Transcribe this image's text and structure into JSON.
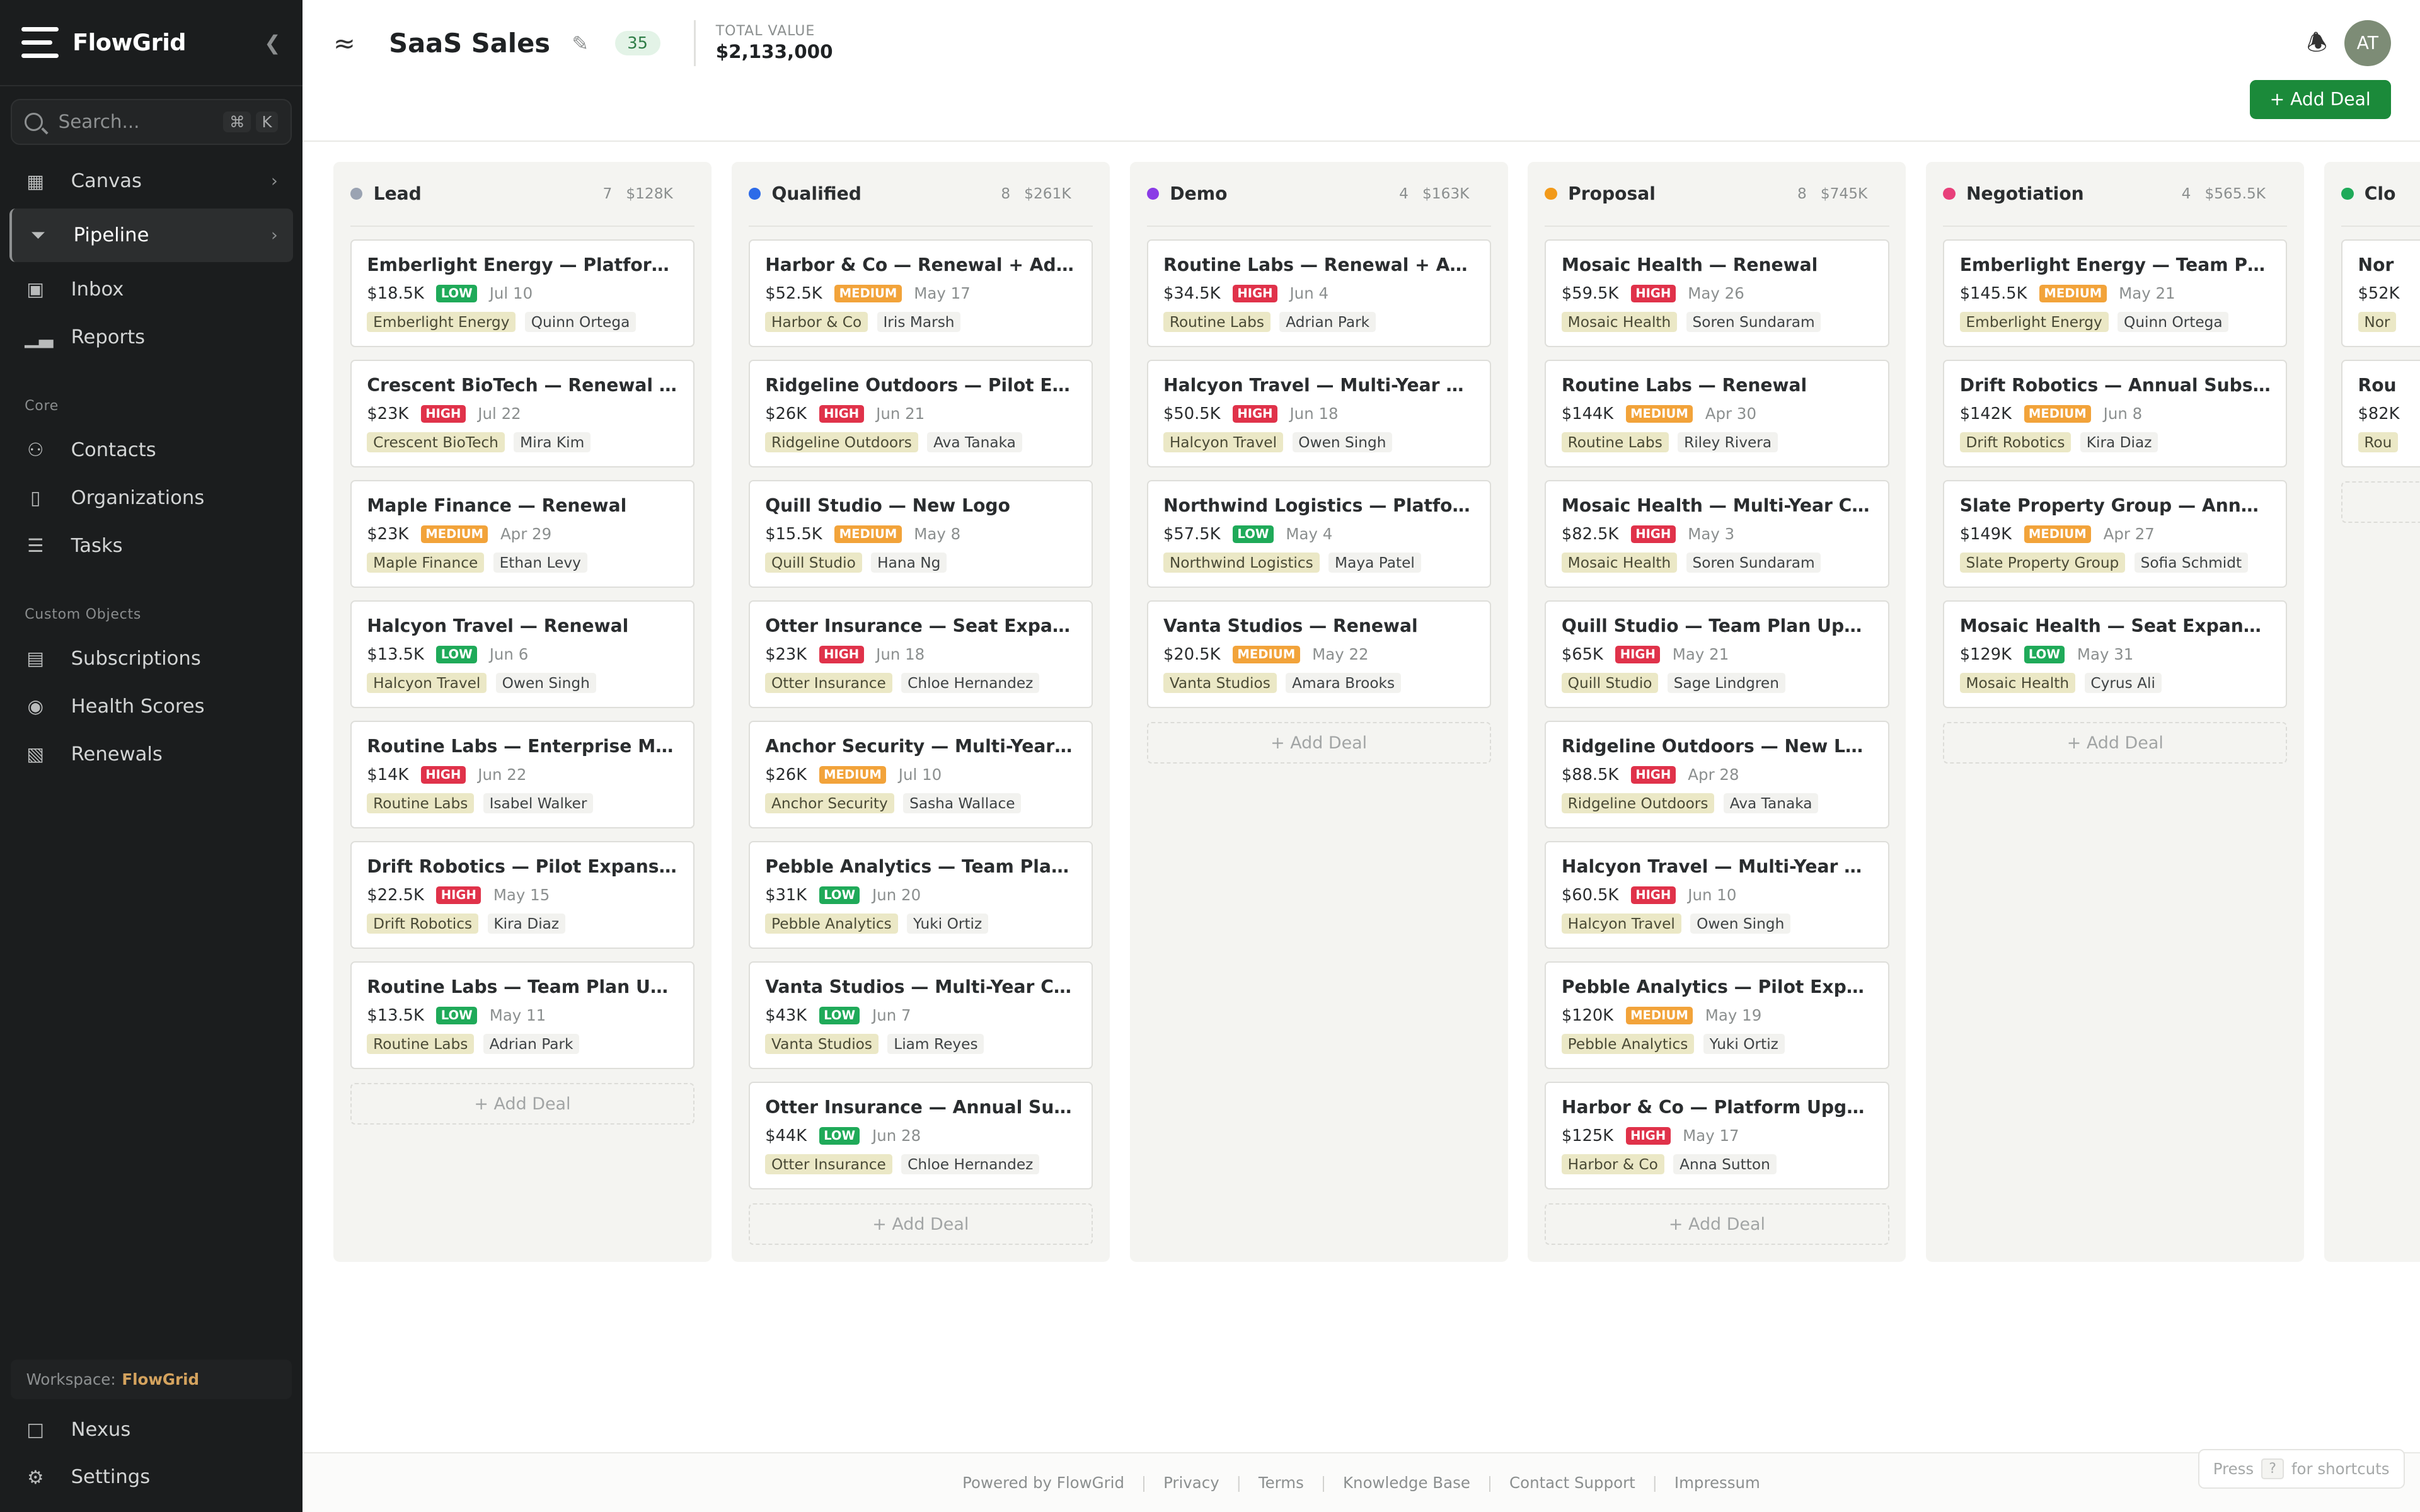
{
  "app": {
    "name": "FlowGrid"
  },
  "sidebar": {
    "search_placeholder": "Search...",
    "shortcut": [
      "⌘",
      "K"
    ],
    "nav": [
      {
        "label": "Canvas",
        "icon": "grid-icon"
      },
      {
        "label": "Pipeline",
        "icon": "filter-icon",
        "active": true
      },
      {
        "label": "Inbox",
        "icon": "inbox-icon"
      },
      {
        "label": "Reports",
        "icon": "bar-chart-icon"
      }
    ],
    "core_label": "Core",
    "core": [
      {
        "label": "Contacts",
        "icon": "users-icon"
      },
      {
        "label": "Organizations",
        "icon": "building-icon"
      },
      {
        "label": "Tasks",
        "icon": "list-icon"
      }
    ],
    "custom_label": "Custom Objects",
    "custom": [
      {
        "label": "Subscriptions",
        "icon": "subscriptions-icon"
      },
      {
        "label": "Health Scores",
        "icon": "health-icon"
      },
      {
        "label": "Renewals",
        "icon": "renewals-icon"
      }
    ],
    "workspace_label": "Workspace:",
    "workspace_name": "FlowGrid",
    "bottom": [
      {
        "label": "Nexus",
        "icon": "chat-icon"
      },
      {
        "label": "Settings",
        "icon": "gear-icon"
      }
    ]
  },
  "header": {
    "title": "SaaS Sales",
    "count": "35",
    "total_label": "TOTAL VALUE",
    "total_value": "$2,133,000",
    "avatar": "AT",
    "add_deal": "+ Add Deal"
  },
  "board": {
    "add_label": "+ Add Deal",
    "columns": [
      {
        "name": "Lead",
        "color": "#9aa3b2",
        "count": "7",
        "total": "$128K",
        "cards": [
          {
            "title": "Emberlight Energy — Platform Upgrade",
            "amount": "$18.5K",
            "priority": "LOW",
            "date": "Jul 10",
            "org": "Emberlight Energy",
            "person": "Quinn Ortega"
          },
          {
            "title": "Crescent BioTech — Renewal + Add-On",
            "amount": "$23K",
            "priority": "HIGH",
            "date": "Jul 22",
            "org": "Crescent BioTech",
            "person": "Mira Kim"
          },
          {
            "title": "Maple Finance — Renewal",
            "amount": "$23K",
            "priority": "MEDIUM",
            "date": "Apr 29",
            "org": "Maple Finance",
            "person": "Ethan Levy"
          },
          {
            "title": "Halcyon Travel — Renewal",
            "amount": "$13.5K",
            "priority": "LOW",
            "date": "Jun 6",
            "org": "Halcyon Travel",
            "person": "Owen Singh"
          },
          {
            "title": "Routine Labs — Enterprise Migration",
            "amount": "$14K",
            "priority": "HIGH",
            "date": "Jun 22",
            "org": "Routine Labs",
            "person": "Isabel Walker"
          },
          {
            "title": "Drift Robotics — Pilot Expansion",
            "amount": "$22.5K",
            "priority": "HIGH",
            "date": "May 15",
            "org": "Drift Robotics",
            "person": "Kira Diaz"
          },
          {
            "title": "Routine Labs — Team Plan Upgrade",
            "amount": "$13.5K",
            "priority": "LOW",
            "date": "May 11",
            "org": "Routine Labs",
            "person": "Adrian Park"
          }
        ]
      },
      {
        "name": "Qualified",
        "color": "#2d6be8",
        "count": "8",
        "total": "$261K",
        "cards": [
          {
            "title": "Harbor & Co — Renewal + Add-On",
            "amount": "$52.5K",
            "priority": "MEDIUM",
            "date": "May 17",
            "org": "Harbor & Co",
            "person": "Iris Marsh"
          },
          {
            "title": "Ridgeline Outdoors — Pilot Expansion",
            "amount": "$26K",
            "priority": "HIGH",
            "date": "Jun 21",
            "org": "Ridgeline Outdoors",
            "person": "Ava Tanaka"
          },
          {
            "title": "Quill Studio — New Logo",
            "amount": "$15.5K",
            "priority": "MEDIUM",
            "date": "May 8",
            "org": "Quill Studio",
            "person": "Hana Ng"
          },
          {
            "title": "Otter Insurance — Seat Expansion",
            "amount": "$23K",
            "priority": "HIGH",
            "date": "Jun 18",
            "org": "Otter Insurance",
            "person": "Chloe Hernandez"
          },
          {
            "title": "Anchor Security — Multi-Year Contract",
            "amount": "$26K",
            "priority": "MEDIUM",
            "date": "Jul 10",
            "org": "Anchor Security",
            "person": "Sasha Wallace"
          },
          {
            "title": "Pebble Analytics — Team Plan Upgrade",
            "amount": "$31K",
            "priority": "LOW",
            "date": "Jun 20",
            "org": "Pebble Analytics",
            "person": "Yuki Ortiz"
          },
          {
            "title": "Vanta Studios — Multi-Year Contract",
            "amount": "$43K",
            "priority": "LOW",
            "date": "Jun 7",
            "org": "Vanta Studios",
            "person": "Liam Reyes"
          },
          {
            "title": "Otter Insurance — Annual Subscription",
            "amount": "$44K",
            "priority": "LOW",
            "date": "Jun 28",
            "org": "Otter Insurance",
            "person": "Chloe Hernandez"
          }
        ]
      },
      {
        "name": "Demo",
        "color": "#8a3ce6",
        "count": "4",
        "total": "$163K",
        "cards": [
          {
            "title": "Routine Labs — Renewal + Add-On",
            "amount": "$34.5K",
            "priority": "HIGH",
            "date": "Jun 4",
            "org": "Routine Labs",
            "person": "Adrian Park"
          },
          {
            "title": "Halcyon Travel — Multi-Year Contract",
            "amount": "$50.5K",
            "priority": "HIGH",
            "date": "Jun 18",
            "org": "Halcyon Travel",
            "person": "Owen Singh"
          },
          {
            "title": "Northwind Logistics — Platform Upgrade",
            "amount": "$57.5K",
            "priority": "LOW",
            "date": "May 4",
            "org": "Northwind Logistics",
            "person": "Maya Patel"
          },
          {
            "title": "Vanta Studios — Renewal",
            "amount": "$20.5K",
            "priority": "MEDIUM",
            "date": "May 22",
            "org": "Vanta Studios",
            "person": "Amara Brooks"
          }
        ]
      },
      {
        "name": "Proposal",
        "color": "#f29a1a",
        "count": "8",
        "total": "$745K",
        "cards": [
          {
            "title": "Mosaic Health — Renewal",
            "amount": "$59.5K",
            "priority": "HIGH",
            "date": "May 26",
            "org": "Mosaic Health",
            "person": "Soren Sundaram"
          },
          {
            "title": "Routine Labs — Renewal",
            "amount": "$144K",
            "priority": "MEDIUM",
            "date": "Apr 30",
            "org": "Routine Labs",
            "person": "Riley Rivera"
          },
          {
            "title": "Mosaic Health — Multi-Year Contract",
            "amount": "$82.5K",
            "priority": "HIGH",
            "date": "May 3",
            "org": "Mosaic Health",
            "person": "Soren Sundaram"
          },
          {
            "title": "Quill Studio — Team Plan Upgrade",
            "amount": "$65K",
            "priority": "HIGH",
            "date": "May 21",
            "org": "Quill Studio",
            "person": "Sage Lindgren"
          },
          {
            "title": "Ridgeline Outdoors — New Logo",
            "amount": "$88.5K",
            "priority": "HIGH",
            "date": "Apr 28",
            "org": "Ridgeline Outdoors",
            "person": "Ava Tanaka"
          },
          {
            "title": "Halcyon Travel — Multi-Year Contract",
            "amount": "$60.5K",
            "priority": "HIGH",
            "date": "Jun 10",
            "org": "Halcyon Travel",
            "person": "Owen Singh"
          },
          {
            "title": "Pebble Analytics — Pilot Expansion",
            "amount": "$120K",
            "priority": "MEDIUM",
            "date": "May 19",
            "org": "Pebble Analytics",
            "person": "Yuki Ortiz"
          },
          {
            "title": "Harbor & Co — Platform Upgrade",
            "amount": "$125K",
            "priority": "HIGH",
            "date": "May 17",
            "org": "Harbor & Co",
            "person": "Anna Sutton"
          }
        ]
      },
      {
        "name": "Negotiation",
        "color": "#e8407a",
        "count": "4",
        "total": "$565.5K",
        "cards": [
          {
            "title": "Emberlight Energy — Team Plan Upgrade",
            "amount": "$145.5K",
            "priority": "MEDIUM",
            "date": "May 21",
            "org": "Emberlight Energy",
            "person": "Quinn Ortega"
          },
          {
            "title": "Drift Robotics — Annual Subscription",
            "amount": "$142K",
            "priority": "MEDIUM",
            "date": "Jun 8",
            "org": "Drift Robotics",
            "person": "Kira Diaz"
          },
          {
            "title": "Slate Property Group — Annual Subscription",
            "amount": "$149K",
            "priority": "MEDIUM",
            "date": "Apr 27",
            "org": "Slate Property Group",
            "person": "Sofia Schmidt"
          },
          {
            "title": "Mosaic Health — Seat Expansion",
            "amount": "$129K",
            "priority": "LOW",
            "date": "May 31",
            "org": "Mosaic Health",
            "person": "Cyrus Ali"
          }
        ]
      },
      {
        "name": "Clo",
        "color": "#1faa59",
        "count": "",
        "total": "",
        "cards": [
          {
            "title": "Nor",
            "amount": "$52K",
            "priority": "",
            "date": "",
            "org": "Nor",
            "person": ""
          },
          {
            "title": "Rou",
            "amount": "$82K",
            "priority": "",
            "date": "",
            "org": "Rou",
            "person": ""
          }
        ]
      }
    ]
  },
  "footer": {
    "links": [
      "Powered by FlowGrid",
      "Privacy",
      "Terms",
      "Knowledge Base",
      "Contact Support",
      "Impressum"
    ],
    "hint_prefix": "Press",
    "hint_key": "?",
    "hint_suffix": "for shortcuts"
  }
}
